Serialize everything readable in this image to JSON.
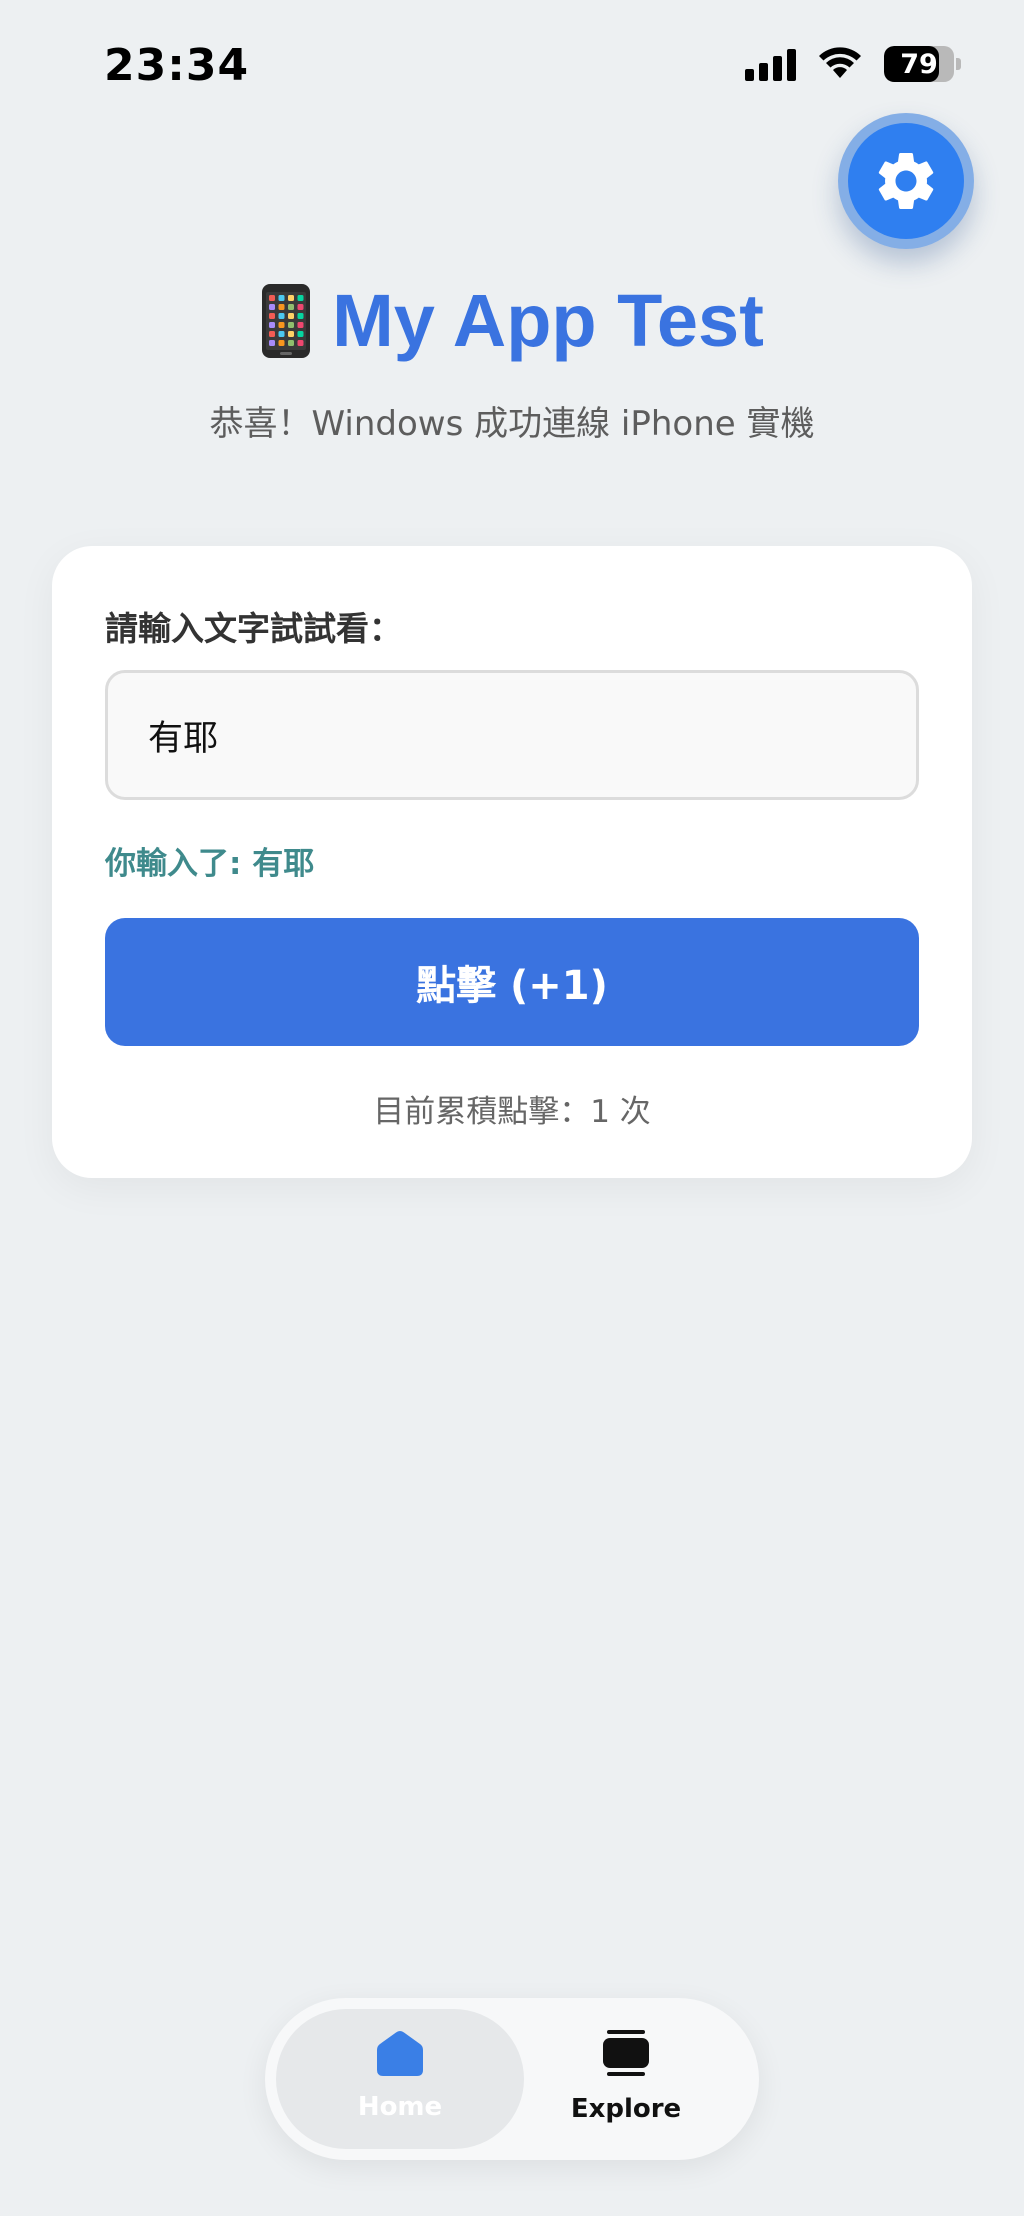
{
  "status_bar": {
    "time": "23:34",
    "battery": "79",
    "battery_level": 0.79
  },
  "header": {
    "phone_emoji": "📱",
    "title": "My App Test",
    "subtitle": "恭喜！Windows 成功連線 iPhone 實機"
  },
  "card": {
    "label": "請輸入文字試試看：",
    "input_value": "有耶",
    "echo_text": "你輸入了: 有耶",
    "button_label": "點擊 (+1)",
    "count_text": "目前累積點擊：1 次"
  },
  "tabbar": {
    "tabs": [
      {
        "label": "Home",
        "icon": "home-icon",
        "active": true
      },
      {
        "label": "Explore",
        "icon": "explore-icon",
        "active": false
      }
    ]
  },
  "colors": {
    "accent": "#3a73e0",
    "fab": "#2f7ff0",
    "echo": "#3f8a8c",
    "background": "#edf0f2"
  }
}
